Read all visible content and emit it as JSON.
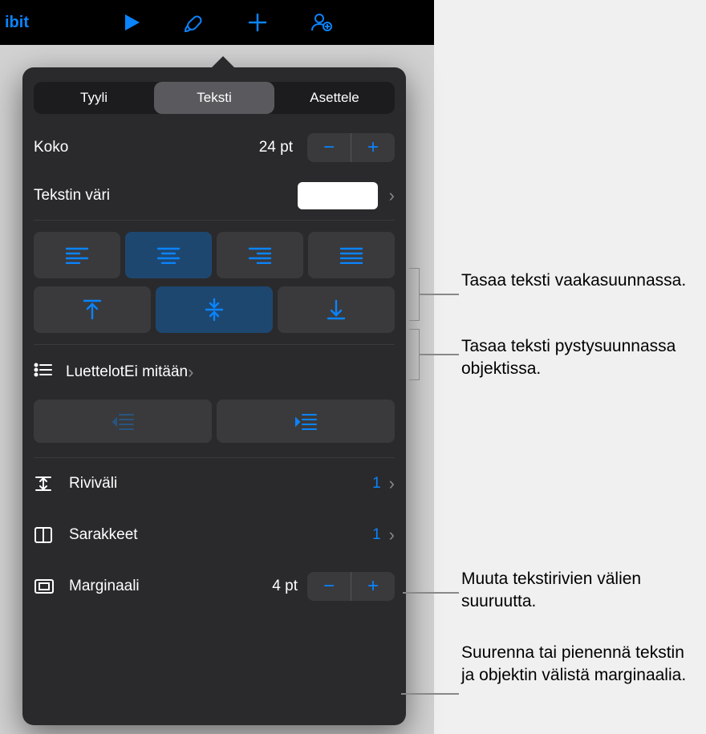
{
  "toolbar": {
    "back_label": "ibit"
  },
  "tabs": {
    "style": "Tyyli",
    "text": "Teksti",
    "layout": "Asettele"
  },
  "size": {
    "label": "Koko",
    "value": "24 pt"
  },
  "text_color": {
    "label": "Tekstin väri"
  },
  "lists": {
    "label": "Luettelot",
    "value": "Ei mitään"
  },
  "line_spacing": {
    "label": "Riviväli",
    "value": "1"
  },
  "columns": {
    "label": "Sarakkeet",
    "value": "1"
  },
  "margin": {
    "label": "Marginaali",
    "value": "4 pt"
  },
  "callouts": {
    "halign": "Tasaa teksti vaakasuunnassa.",
    "valign": "Tasaa teksti pystysuunnassa objektissa.",
    "spacing": "Muuta tekstirivien välien suuruutta.",
    "margin": "Suurenna tai pienennä tekstin ja objektin välistä marginaalia."
  }
}
